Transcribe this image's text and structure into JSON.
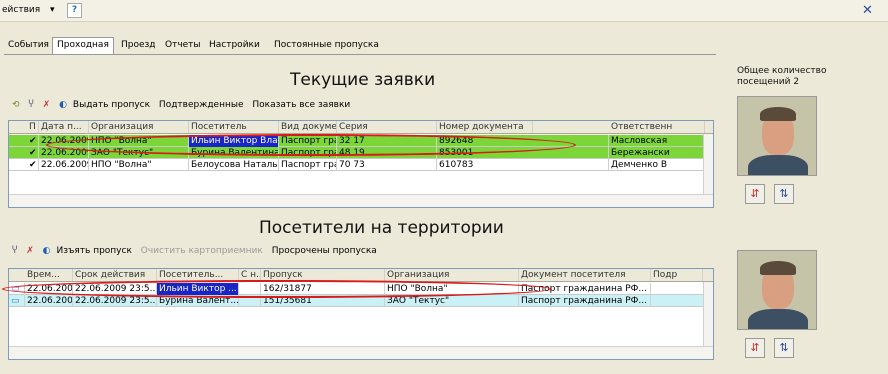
{
  "menu": {
    "actions": "ействия",
    "help": "?",
    "close": "✕"
  },
  "tabs": [
    "События",
    "Проходная",
    "Проезд",
    "Отчеты",
    "Настройки",
    "Постоянные пропуска"
  ],
  "active_tab": 1,
  "current": {
    "title": "Текущие заявки",
    "toolbar": [
      "Выдать пропуск",
      "Подтвержденные",
      "Показать все заявки"
    ],
    "headers": [
      "П",
      "Дата п...",
      "Организация",
      "Посетитель",
      "Вид докумен...",
      "Серия",
      "Номер документа",
      "Ответственн"
    ],
    "rows": [
      {
        "check": "✔",
        "date": "22.06.2009",
        "org": "НПО \"Волна\"",
        "visitor": "Ильин Виктор Влад...",
        "doc": "Паспорт гра...",
        "series": "32 17",
        "number": "892648",
        "resp": "Масловская"
      },
      {
        "check": "✔",
        "date": "22.06.2009",
        "org": "ЗАО \"Тектус\"",
        "visitor": "Бурина Валентина ...",
        "doc": "Паспорт гра...",
        "series": "48 19",
        "number": "853001",
        "resp": "Бережански"
      },
      {
        "check": "✔",
        "date": "22.06.2009",
        "org": "НПО \"Волна\"",
        "visitor": "Белоусова Наталья...",
        "doc": "Паспорт гра...",
        "series": "70 73",
        "number": "610783",
        "resp": "Демченко В"
      }
    ]
  },
  "territory": {
    "title": "Посетители на территории",
    "toolbar": [
      "Изъять пропуск",
      "Очистить картоприемник",
      "Просрочены пропуска"
    ],
    "headers": [
      "Врем...",
      "Срок действия",
      "Посетитель...",
      "С н...",
      "Пропуск",
      "Организация",
      "Документ посетителя",
      "Подр"
    ],
    "rows": [
      {
        "time": "22.06.200...",
        "valid": "22.06.2009 23:5...",
        "visitor": "Ильин Виктор ...",
        "sn": "",
        "pass": "162/31877",
        "org": "НПО \"Волна\"",
        "doc": "Паспорт гражданина РФ..."
      },
      {
        "time": "22.06.200...",
        "valid": "22.06.2009 23:5...",
        "visitor": "Бурина Валент...",
        "sn": "",
        "pass": "151/35681",
        "org": "ЗАО \"Тектус\"",
        "doc": "Паспорт гражданина РФ..."
      }
    ]
  },
  "side": {
    "label": "Общее количество посещений 2"
  },
  "colors": {
    "green": "#7cd638",
    "cyan": "#c9f1f6",
    "selection": "#1826c9",
    "oval": "#d81b1b"
  }
}
